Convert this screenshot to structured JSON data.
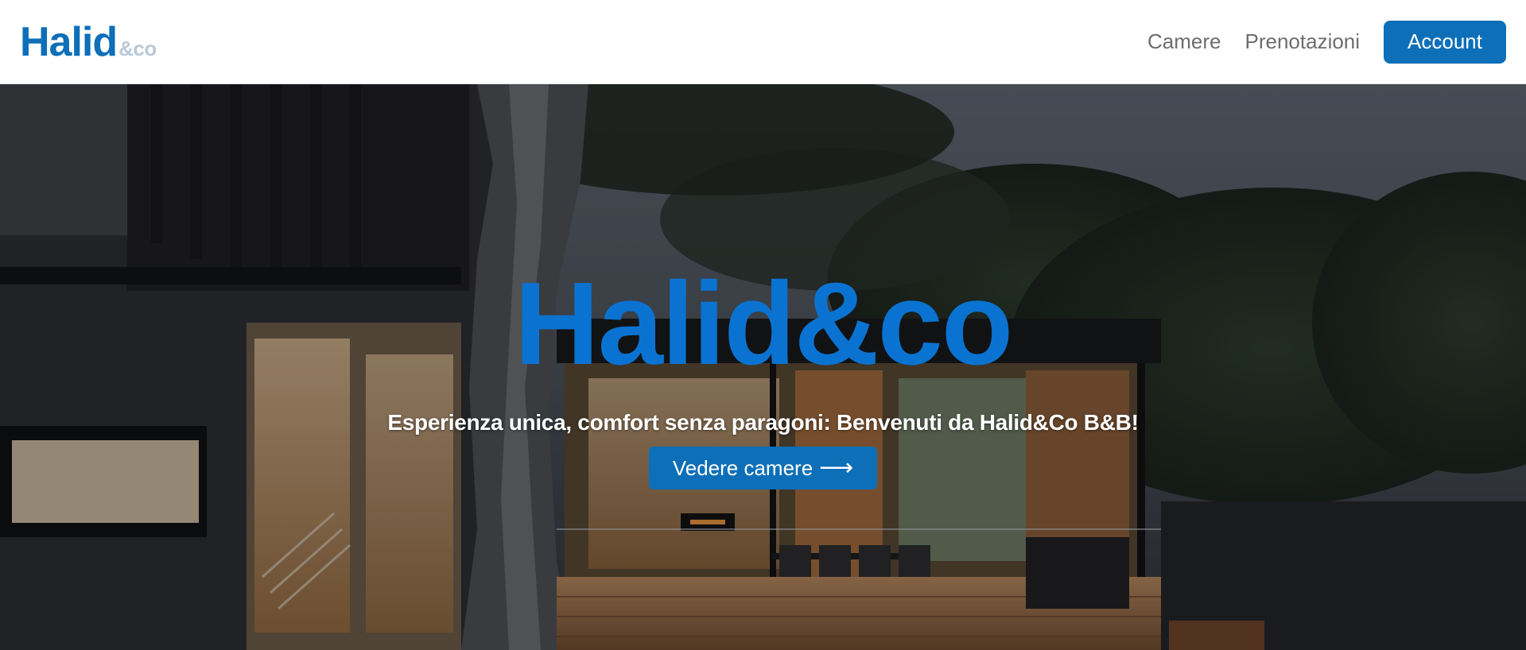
{
  "navbar": {
    "brand_main": "Halid",
    "brand_sub": "&co",
    "links": [
      "Camere",
      "Prenotazioni"
    ],
    "account_label": "Account"
  },
  "hero": {
    "title": "Halid&co",
    "subtitle": "Esperienza unica, comfort senza paragoni: Benvenuti da Halid&Co B&B!",
    "cta_label": "Vedere camere",
    "cta_icon": "arrow-right-icon"
  },
  "colors": {
    "brand_blue": "#0d6fb8",
    "title_blue": "#0a73d1",
    "nav_text": "#6d6d6d",
    "brand_sub": "#b9c9d6"
  }
}
